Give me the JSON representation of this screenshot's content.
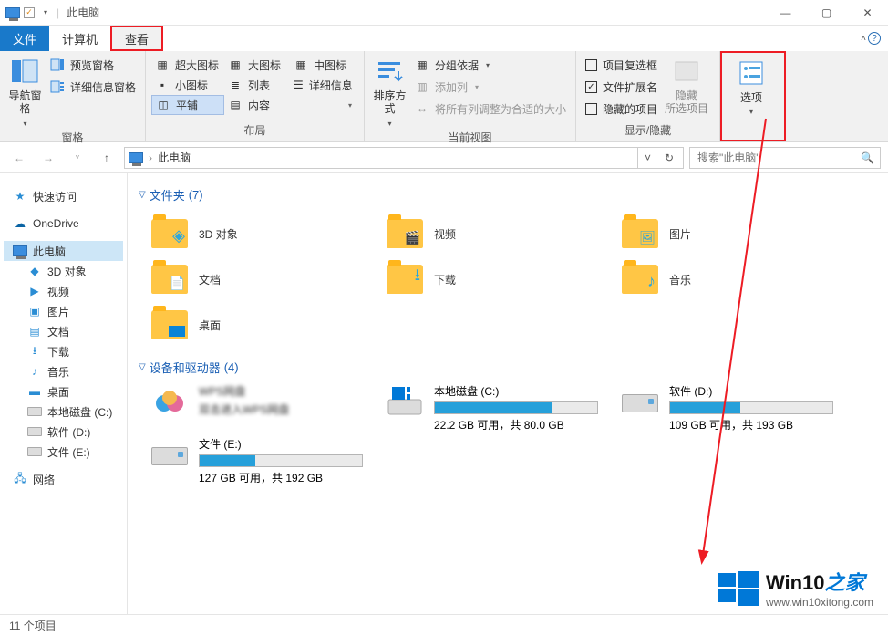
{
  "title": "此电脑",
  "tabs": {
    "file": "文件",
    "computer": "计算机",
    "view": "查看"
  },
  "ribbon": {
    "panes": {
      "label": "窗格",
      "navpane": "导航窗格",
      "preview": "预览窗格",
      "details": "详细信息窗格"
    },
    "layout": {
      "label": "布局",
      "xlarge": "超大图标",
      "large": "大图标",
      "medium": "中图标",
      "small": "小图标",
      "list": "列表",
      "details": "详细信息",
      "tiles": "平铺",
      "content": "内容"
    },
    "currentview": {
      "label": "当前视图",
      "sort": "排序方式",
      "group": "分组依据",
      "addcol": "添加列",
      "fitcols": "将所有列调整为合适的大小"
    },
    "showhide": {
      "label": "显示/隐藏",
      "chkboxes": "项目复选框",
      "ext": "文件扩展名",
      "hidden": "隐藏的项目",
      "hidesel": "隐藏\n所选项目"
    },
    "options": "选项"
  },
  "address": {
    "location": "此电脑"
  },
  "search": {
    "placeholder": "搜索\"此电脑\""
  },
  "sidebar": {
    "quick": "快速访问",
    "onedrive": "OneDrive",
    "thispc": "此电脑",
    "children": {
      "objects3d": "3D 对象",
      "videos": "视频",
      "pictures": "图片",
      "documents": "文档",
      "downloads": "下载",
      "music": "音乐",
      "desktop": "桌面",
      "cdrive": "本地磁盘 (C:)",
      "ddrive": "软件 (D:)",
      "edrive": "文件 (E:)"
    },
    "network": "网络"
  },
  "groups": {
    "folders": {
      "label": "文件夹",
      "count": "(7)"
    },
    "drives": {
      "label": "设备和驱动器",
      "count": "(4)"
    }
  },
  "folders": {
    "objects3d": "3D 对象",
    "videos": "视频",
    "pictures": "图片",
    "documents": "文档",
    "downloads": "下载",
    "music": "音乐",
    "desktop": "桌面"
  },
  "drives": {
    "wps": {
      "name": "WPS网盘",
      "sub": "双击进入WPS网盘"
    },
    "c": {
      "name": "本地磁盘 (C:)",
      "stat": "22.2 GB 可用，共 80.0 GB",
      "pct": 72
    },
    "d": {
      "name": "软件 (D:)",
      "stat": "109 GB 可用，共 193 GB",
      "pct": 43
    },
    "e": {
      "name": "文件 (E:)",
      "stat": "127 GB 可用，共 192 GB",
      "pct": 34
    }
  },
  "status": "11 个项目",
  "watermark": {
    "brand": "Win10",
    "suffix": "之家",
    "url": "www.win10xitong.com"
  }
}
